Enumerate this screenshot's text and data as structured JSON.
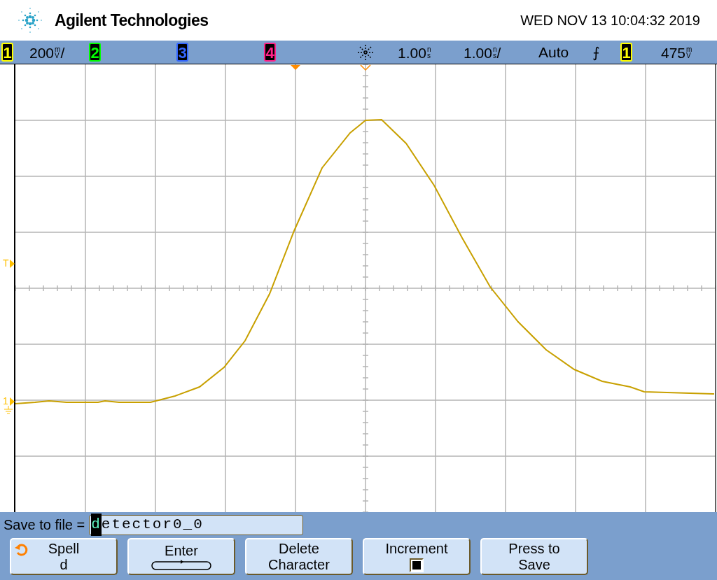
{
  "header": {
    "brand": "Agilent Technologies",
    "datetime": "WED NOV 13 10:04:32 2019"
  },
  "status_bar": {
    "channels": [
      {
        "label": "1",
        "color": "#ffff00",
        "scale": {
          "value": "200",
          "unit_top": "m",
          "unit_bottom": "V",
          "suffix": "/"
        }
      },
      {
        "label": "2",
        "color": "#00ff00"
      },
      {
        "label": "3",
        "color": "#3366ff"
      },
      {
        "label": "4",
        "color": "#ff2288"
      }
    ],
    "delay": {
      "value": "1.00",
      "unit_top": "n",
      "unit_bottom": "s"
    },
    "timebase": {
      "value": "1.00",
      "unit_top": "n",
      "unit_bottom": "s",
      "suffix": "/"
    },
    "trigger_mode": "Auto",
    "trigger_slope": "⨍",
    "trigger_source": {
      "label": "1",
      "color": "#ffff00"
    },
    "trigger_level": {
      "value": "475",
      "unit_top": "m",
      "unit_bottom": "V"
    }
  },
  "plot": {
    "trigger_marker": "T",
    "channel_marker": "1"
  },
  "softkeys": {
    "prompt": "Save to file =",
    "filename": "detector0_0",
    "buttons": [
      {
        "kind": "spell",
        "label": "Spell",
        "value": "d"
      },
      {
        "kind": "enter",
        "label": "Enter"
      },
      {
        "kind": "text",
        "label": "Delete Character"
      },
      {
        "kind": "checkbox",
        "label": "Increment",
        "checked": true
      },
      {
        "kind": "text",
        "label": "Press to Save"
      }
    ]
  }
}
